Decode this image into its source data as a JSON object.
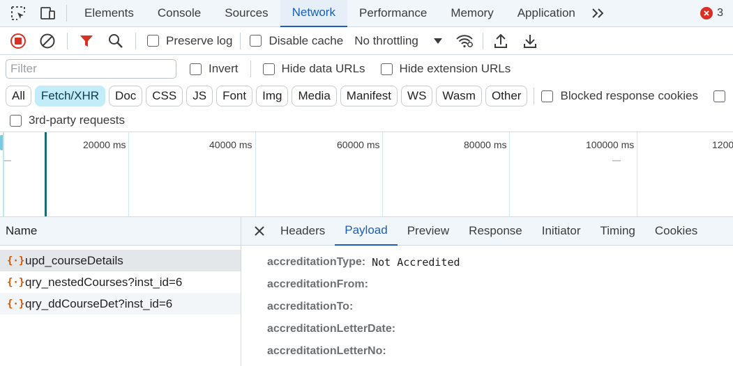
{
  "tabbar": {
    "tabs": [
      {
        "label": "Elements"
      },
      {
        "label": "Console"
      },
      {
        "label": "Sources"
      },
      {
        "label": "Network"
      },
      {
        "label": "Performance"
      },
      {
        "label": "Memory"
      },
      {
        "label": "Application"
      }
    ],
    "active_tab": "Network",
    "error_count": "3"
  },
  "toolbar": {
    "preserve_log": "Preserve log",
    "disable_cache": "Disable cache",
    "throttling": "No throttling"
  },
  "filters": {
    "filter_placeholder": "Filter",
    "invert": "Invert",
    "hide_data_urls": "Hide data URLs",
    "hide_extension_urls": "Hide extension URLs",
    "types": [
      "All",
      "Fetch/XHR",
      "Doc",
      "CSS",
      "JS",
      "Font",
      "Img",
      "Media",
      "Manifest",
      "WS",
      "Wasm",
      "Other"
    ],
    "active_type": "Fetch/XHR",
    "blocked_response_cookies": "Blocked response cookies",
    "third_party": "3rd-party requests"
  },
  "overview": {
    "ticks": [
      "20000 ms",
      "40000 ms",
      "60000 ms",
      "80000 ms",
      "100000 ms",
      "1200"
    ]
  },
  "requests": {
    "header": "Name",
    "rows": [
      {
        "name": "upd_courseDetails"
      },
      {
        "name": "qry_nestedCourses?inst_id=6"
      },
      {
        "name": "qry_ddCourseDet?inst_id=6"
      }
    ]
  },
  "detail": {
    "tabs": [
      "Headers",
      "Payload",
      "Preview",
      "Response",
      "Initiator",
      "Timing",
      "Cookies"
    ],
    "active_tab": "Payload",
    "payload": [
      {
        "key": "accreditationType:",
        "value": "Not Accredited"
      },
      {
        "key": "accreditationFrom:",
        "value": ""
      },
      {
        "key": "accreditationTo:",
        "value": ""
      },
      {
        "key": "accreditationLetterDate:",
        "value": ""
      },
      {
        "key": "accreditationLetterNo:",
        "value": ""
      }
    ]
  },
  "colors": {
    "accent": "#1a5fb4",
    "record_red": "#d93025",
    "active_pill": "#c2ecf8",
    "xhr_icon": "#d35400"
  }
}
